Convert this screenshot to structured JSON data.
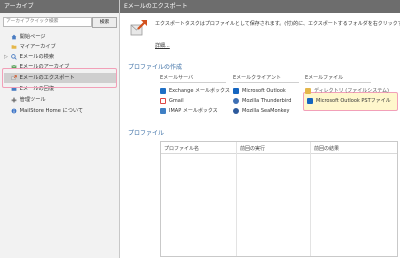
{
  "left": {
    "header": "アーカイブ",
    "search_placeholder": "アーカイブクイック検索",
    "search_button": "検索",
    "tree": [
      {
        "label": "開始ページ",
        "icon": "home-icon"
      },
      {
        "label": "マイアーカイブ",
        "icon": "folder-icon"
      },
      {
        "label": "Eメールの検索",
        "icon": "search-icon"
      },
      {
        "label": "Eメールのアーカイブ",
        "icon": "archive-icon"
      },
      {
        "label": "Eメールのエクスポート",
        "icon": "export-icon"
      },
      {
        "label": "Eメールの回復",
        "icon": "restore-icon"
      },
      {
        "label": "管理ツール",
        "icon": "tools-icon"
      },
      {
        "label": "MailStore Home について",
        "icon": "info-icon"
      }
    ]
  },
  "right": {
    "header": "Eメールのエクスポート",
    "description": "エクスポートタスクはプロファイルとして保存されます。(付)的に、エクスポートするフォルダを右クリックすることもできます。",
    "details_link": "詳細...",
    "create_profile_title": "プロファイルの作成",
    "columns": [
      {
        "title": "Eメールサーバ",
        "items": [
          {
            "label": "Exchange メールボックス",
            "icon": "exchange-icon"
          },
          {
            "label": "Gmail",
            "icon": "gmail-icon"
          },
          {
            "label": "IMAP メールボックス",
            "icon": "imap-icon"
          }
        ]
      },
      {
        "title": "Eメールクライアント",
        "items": [
          {
            "label": "Microsoft Outlook",
            "icon": "outlook-icon"
          },
          {
            "label": "Mozilla Thunderbird",
            "icon": "thunderbird-icon"
          },
          {
            "label": "Mozilla SeaMonkey",
            "icon": "seamonkey-icon"
          }
        ]
      },
      {
        "title": "Eメールファイル",
        "items": [
          {
            "label": "ディレクトリ (ファイルシステム)",
            "icon": "directory-icon"
          },
          {
            "label": "Microsoft Outlook PSTファイル",
            "icon": "pst-icon"
          }
        ]
      }
    ],
    "profiles_title": "プロファイル",
    "table_headers": [
      "プロファイル名",
      "前回の実行",
      "前回の結果"
    ]
  },
  "colors": {
    "header_bg": "#6d6d6d",
    "section_title": "#3a6ea5",
    "highlight_border": "#f2a0b8",
    "selected_bg": "#cfcfcf"
  }
}
